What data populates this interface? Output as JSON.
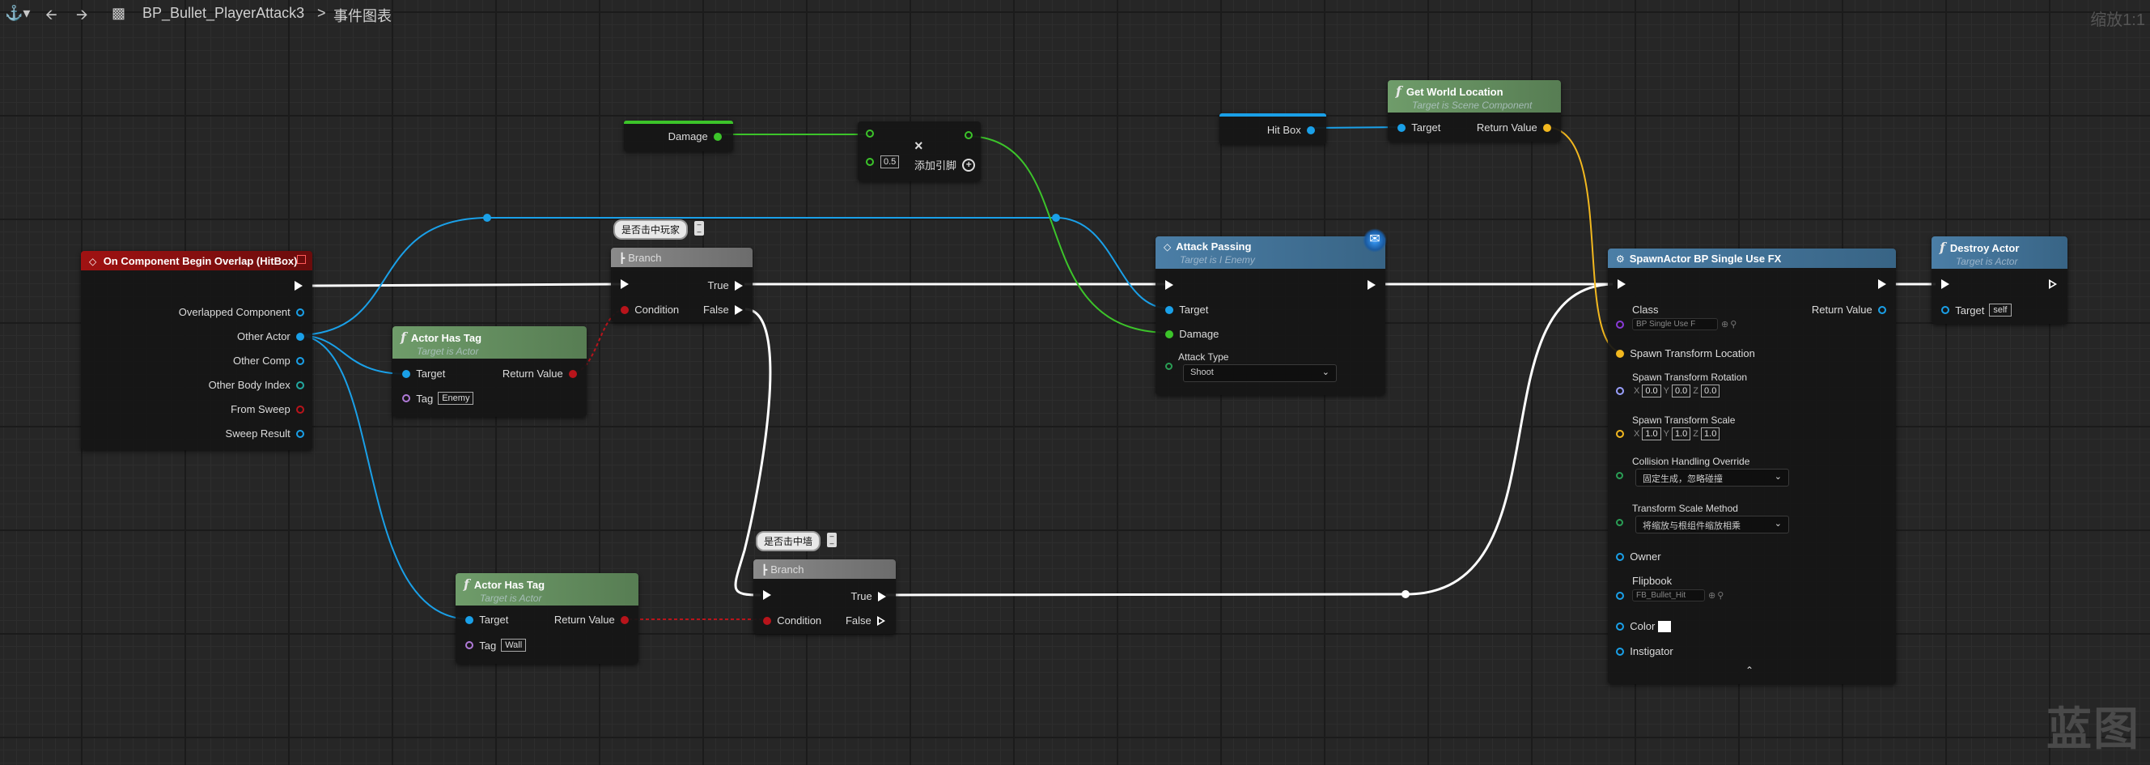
{
  "toolbar": {
    "bookmark_icon": "bookmark-icon",
    "back_icon": "arrow-left-icon",
    "forward_icon": "arrow-right-icon",
    "graph_icon": "blueprint-graph-icon"
  },
  "breadcrumb": {
    "blueprint": "BP_Bullet_PlayerAttack3",
    "separator": ">",
    "graph": "事件图表"
  },
  "zoom_label": "缩放1:1",
  "watermark": "蓝图",
  "comments": {
    "hit_player": "是否击中玩家",
    "hit_wall": "是否击中墙"
  },
  "nodes": {
    "on_overlap": {
      "title": "On Component Begin Overlap (HitBox)",
      "pins": [
        "Overlapped Component",
        "Other Actor",
        "Other Comp",
        "Other Body Index",
        "From Sweep",
        "Sweep Result"
      ]
    },
    "has_tag_enemy": {
      "title": "Actor Has Tag",
      "subtitle": "Target is Actor",
      "target": "Target",
      "return_value": "Return Value",
      "tag_label": "Tag",
      "tag_value": "Enemy"
    },
    "has_tag_wall": {
      "title": "Actor Has Tag",
      "subtitle": "Target is Actor",
      "target": "Target",
      "return_value": "Return Value",
      "tag_label": "Tag",
      "tag_value": "Wall"
    },
    "branch1": {
      "title": "Branch",
      "condition": "Condition",
      "true": "True",
      "false": "False"
    },
    "branch2": {
      "title": "Branch",
      "condition": "Condition",
      "true": "True",
      "false": "False"
    },
    "damage_var": {
      "label": "Damage"
    },
    "multiply": {
      "value": "0.5",
      "add_pin": "添加引脚"
    },
    "hitbox_var": {
      "label": "Hit Box"
    },
    "get_world_location": {
      "title": "Get World Location",
      "subtitle": "Target is Scene Component",
      "target": "Target",
      "return_value": "Return Value"
    },
    "attack_passing": {
      "title": "Attack Passing",
      "subtitle": "Target is I Enemy",
      "target": "Target",
      "damage": "Damage",
      "attack_type_label": "Attack Type",
      "attack_type_value": "Shoot"
    },
    "spawn_actor": {
      "title": "SpawnActor BP Single Use FX",
      "class_label": "Class",
      "class_value": "BP Single Use F",
      "return_value": "Return Value",
      "spawn_location": "Spawn Transform Location",
      "spawn_rotation": "Spawn Transform Rotation",
      "rot": {
        "x_label": "X",
        "x": "0.0",
        "y_label": "Y",
        "y": "0.0",
        "z_label": "Z",
        "z": "0.0"
      },
      "spawn_scale": "Spawn Transform Scale",
      "scale": {
        "x_label": "X",
        "x": "1.0",
        "y_label": "Y",
        "y": "1.0",
        "z_label": "Z",
        "z": "1.0"
      },
      "collision_label": "Collision Handling Override",
      "collision_value": "固定生成，忽略碰撞",
      "scale_method_label": "Transform Scale Method",
      "scale_method_value": "将缩放与根组件缩放相乘",
      "owner": "Owner",
      "flipbook_label": "Flipbook",
      "flipbook_value": "FB_Bullet_Hit",
      "color": "Color",
      "instigator": "Instigator"
    },
    "destroy_actor": {
      "title": "Destroy Actor",
      "subtitle": "Target is Actor",
      "target": "Target",
      "self": "self"
    }
  },
  "colors": {
    "exec": "#ffffff",
    "object": "#1aa0e8",
    "bool": "#b8141b",
    "float": "#3cc42a",
    "vector": "#f2b81f",
    "event_header": "#a01212",
    "function_header": "#6f9c6a",
    "interface_header": "#4b7ea6"
  }
}
